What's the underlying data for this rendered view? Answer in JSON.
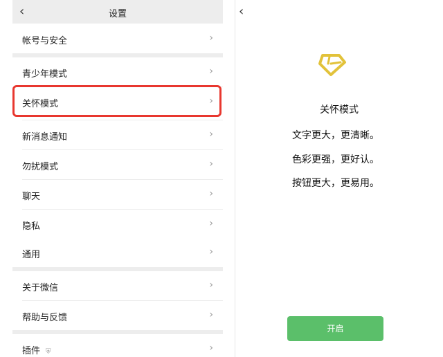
{
  "settings": {
    "title": "设置",
    "items": [
      {
        "label": "帐号与安全"
      },
      {
        "label": "青少年模式"
      },
      {
        "label": "关怀模式"
      },
      {
        "label": "新消息通知"
      },
      {
        "label": "勿扰模式"
      },
      {
        "label": "聊天"
      },
      {
        "label": "隐私"
      },
      {
        "label": "通用"
      },
      {
        "label": "关于微信"
      },
      {
        "label": "帮助与反馈"
      },
      {
        "label": "插件"
      }
    ]
  },
  "care_mode": {
    "title": "关怀模式",
    "lines": [
      "文字更大，更清晰。",
      "色彩更强，更好认。",
      "按钮更大，更易用。"
    ],
    "button_label": "开启"
  },
  "colors": {
    "highlight": "#e8372f",
    "accent_green": "#5bbf6a",
    "icon_yellow": "#e2c23a"
  }
}
